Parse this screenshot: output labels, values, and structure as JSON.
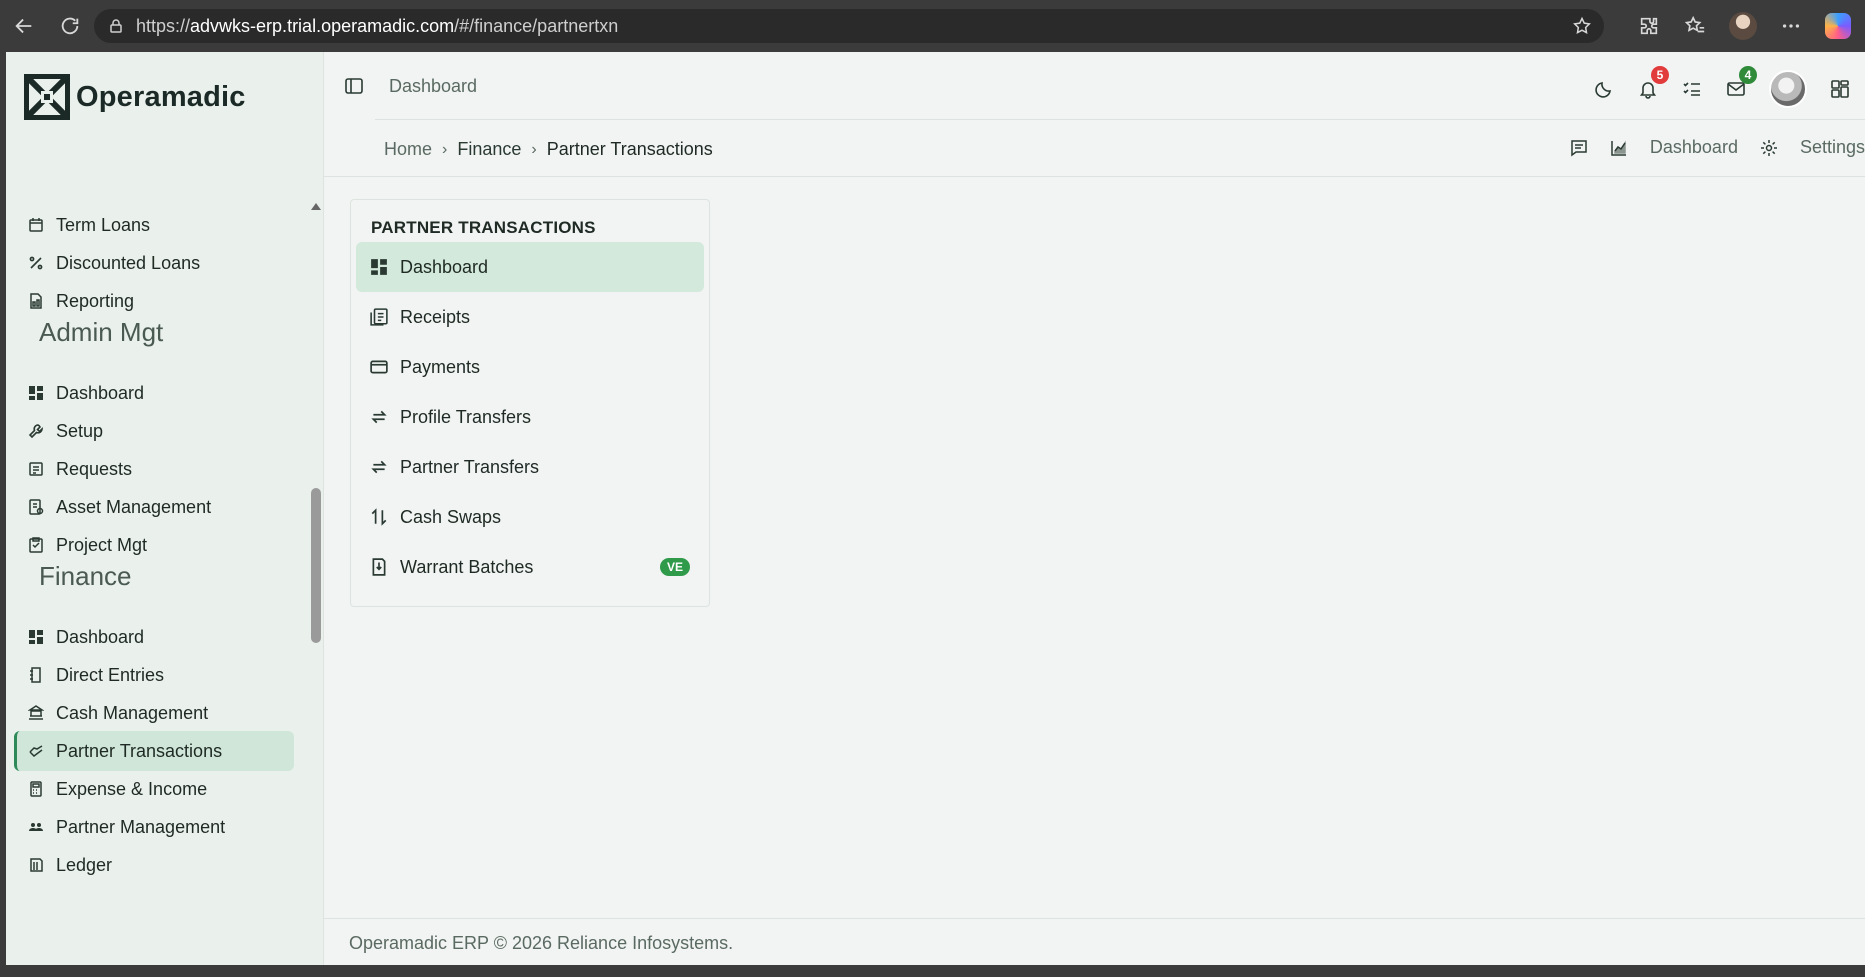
{
  "browser": {
    "url_prefix": "https://",
    "url_host": "advwks-erp.trial.operamadic.com",
    "url_path": "/#/finance/partnertxn"
  },
  "brand": {
    "name": "Operamadic"
  },
  "sidebar": {
    "items_top": [
      {
        "label": "Term Loans",
        "icon": "calendar-icon"
      },
      {
        "label": "Discounted Loans",
        "icon": "percent-icon"
      },
      {
        "label": "Reporting",
        "icon": "report-icon"
      }
    ],
    "admin_section": "Admin Mgt",
    "admin_items": [
      {
        "label": "Dashboard",
        "icon": "dashboard-icon"
      },
      {
        "label": "Setup",
        "icon": "wrench-icon"
      },
      {
        "label": "Requests",
        "icon": "requests-icon"
      },
      {
        "label": "Asset Management",
        "icon": "asset-icon"
      },
      {
        "label": "Project Mgt",
        "icon": "project-icon"
      }
    ],
    "finance_section": "Finance",
    "finance_items": [
      {
        "label": "Dashboard",
        "icon": "dashboard-icon"
      },
      {
        "label": "Direct Entries",
        "icon": "entries-icon"
      },
      {
        "label": "Cash Management",
        "icon": "cash-icon"
      },
      {
        "label": "Partner Transactions",
        "icon": "partner-icon",
        "active": true
      },
      {
        "label": "Expense & Income",
        "icon": "calculator-icon"
      },
      {
        "label": "Partner Management",
        "icon": "people-icon"
      },
      {
        "label": "Ledger",
        "icon": "ledger-icon"
      }
    ]
  },
  "topbar": {
    "title": "Dashboard",
    "notifications_count": "5",
    "messages_count": "4"
  },
  "breadcrumb": {
    "home": "Home",
    "section": "Finance",
    "current": "Partner Transactions",
    "actions": {
      "dashboard": "Dashboard",
      "settings": "Settings"
    }
  },
  "panel": {
    "title": "PARTNER TRANSACTIONS",
    "items": [
      {
        "label": "Dashboard",
        "icon": "dashboard-icon",
        "active": true
      },
      {
        "label": "Receipts",
        "icon": "receipt-icon"
      },
      {
        "label": "Payments",
        "icon": "card-icon"
      },
      {
        "label": "Profile Transfers",
        "icon": "transfer-icon"
      },
      {
        "label": "Partner Transfers",
        "icon": "transfer-icon"
      },
      {
        "label": "Cash Swaps",
        "icon": "swap-icon"
      },
      {
        "label": "Warrant Batches",
        "icon": "batch-icon",
        "pill": "VE"
      }
    ]
  },
  "footer": {
    "text": "Operamadic ERP © 2026 Reliance Infosystems."
  },
  "colors": {
    "accent": "#2f8a5a",
    "active_bg": "#cfe6d8",
    "badge_red": "#e23b3b",
    "badge_green": "#2f8a3a"
  }
}
